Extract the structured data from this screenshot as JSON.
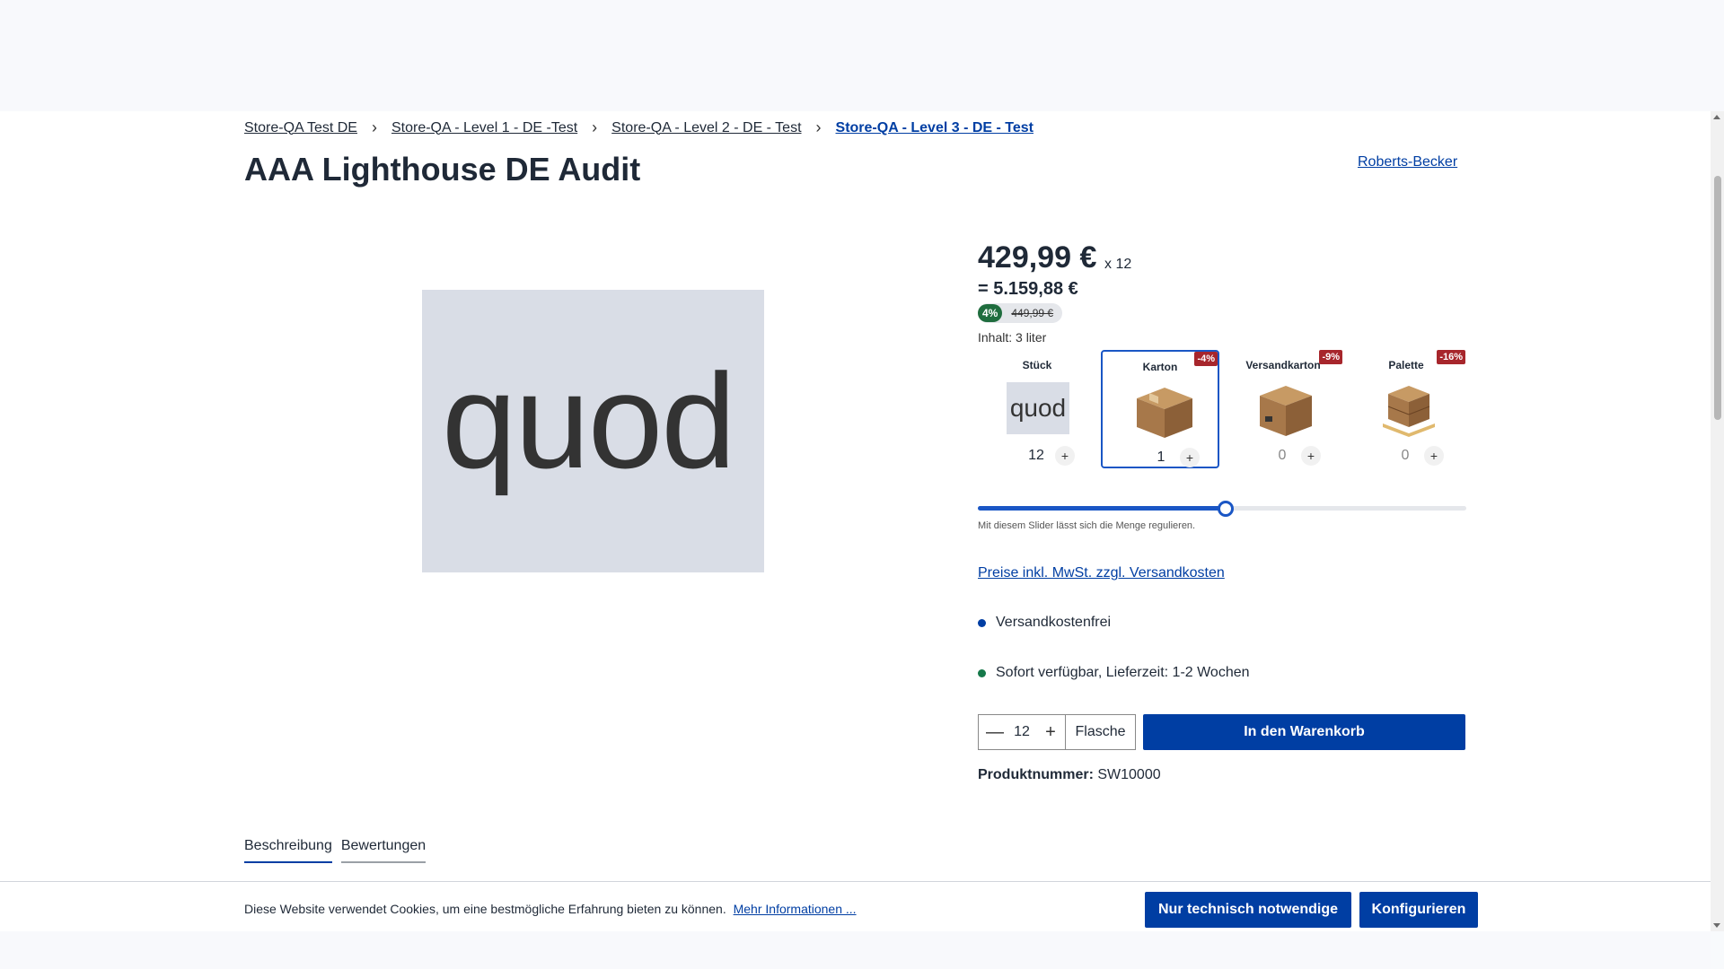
{
  "breadcrumb": [
    {
      "label": "Store-QA Test DE"
    },
    {
      "label": "Store-QA - Level 1 - DE -Test"
    },
    {
      "label": "Store-QA - Level 2 - DE - Test"
    },
    {
      "label": "Store-QA - Level 3 - DE - Test"
    }
  ],
  "product": {
    "title": "AAA Lighthouse DE Audit",
    "manufacturer": "Roberts-Becker",
    "image_text": "quod",
    "price": "429,99 €",
    "price_multiplier": "x 12",
    "total": "= 5.159,88 €",
    "discount_badge": "4%",
    "old_price": "449,99 €",
    "content": "Inhalt: 3 liter",
    "product_number_label": "Produktnummer:",
    "product_number": "SW10000"
  },
  "packs": [
    {
      "name": "Stück",
      "badge": "",
      "qty": "12",
      "plus": "+",
      "thumb": "quod",
      "icon": "bottle-thumbnail"
    },
    {
      "name": "Karton",
      "badge": "-4%",
      "qty": "1",
      "plus": "+",
      "icon": "box-icon"
    },
    {
      "name": "Versandkarton",
      "badge": "-9%",
      "qty": "0",
      "plus": "+",
      "icon": "shipping-box-icon"
    },
    {
      "name": "Palette",
      "badge": "-16%",
      "qty": "0",
      "plus": "+",
      "icon": "pallet-icon"
    }
  ],
  "slider": {
    "value_fraction": 0.507,
    "hint": "Mit diesem Slider lässt sich die Menge regulieren."
  },
  "tax_link": "Preise inkl. MwSt. zzgl. Versandkosten",
  "delivery": [
    {
      "text": "Versandkostenfrei",
      "color": "#003ea3"
    },
    {
      "text": "Sofort verfügbar, Lieferzeit: 1-2 Wochen",
      "color": "#16794a"
    }
  ],
  "buy": {
    "minus": "—",
    "qty": "12",
    "plus": "+",
    "unit": "Flasche",
    "cart_label": "In den Warenkorb"
  },
  "tabs": [
    {
      "label": "Beschreibung",
      "active": true
    },
    {
      "label": "Bewertungen",
      "active": false
    }
  ],
  "cookie": {
    "text": "Diese Website verwendet Cookies, um eine bestmögliche Erfahrung bieten zu können.",
    "link": "Mehr Informationen ...",
    "btn_necessary": "Nur technisch notwendige",
    "btn_configure": "Konfigurieren"
  },
  "colors": {
    "primary": "#003ea3",
    "accent": "#1a56c5",
    "discount_badge": "#a7262c",
    "savings_badge": "#1f6d3e"
  }
}
